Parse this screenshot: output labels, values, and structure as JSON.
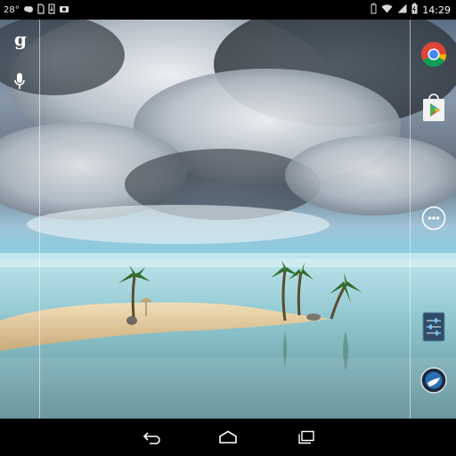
{
  "status_bar": {
    "temperature": "28°",
    "time": "14:29",
    "left_icons": [
      "weather-icon",
      "sd-card-icon",
      "download-icon",
      "gallery-icon"
    ],
    "right_icons": [
      "battery-icon",
      "wifi-icon",
      "signal-icon",
      "charging-battery-icon"
    ]
  },
  "left_bar": {
    "icons": [
      "google-search-icon",
      "microphone-icon"
    ]
  },
  "hotseat": {
    "icons": [
      "chrome-icon",
      "play-store-icon",
      "app-drawer-icon",
      "settings-icon",
      "google-earth-icon"
    ]
  },
  "nav_bar": {
    "buttons": [
      "back-icon",
      "home-icon",
      "recents-icon"
    ]
  },
  "colors": {
    "status_bar": "#000000",
    "nav_bar": "#000000",
    "clock_text": "#ffffff",
    "status_icon": "#d8d8d8"
  }
}
